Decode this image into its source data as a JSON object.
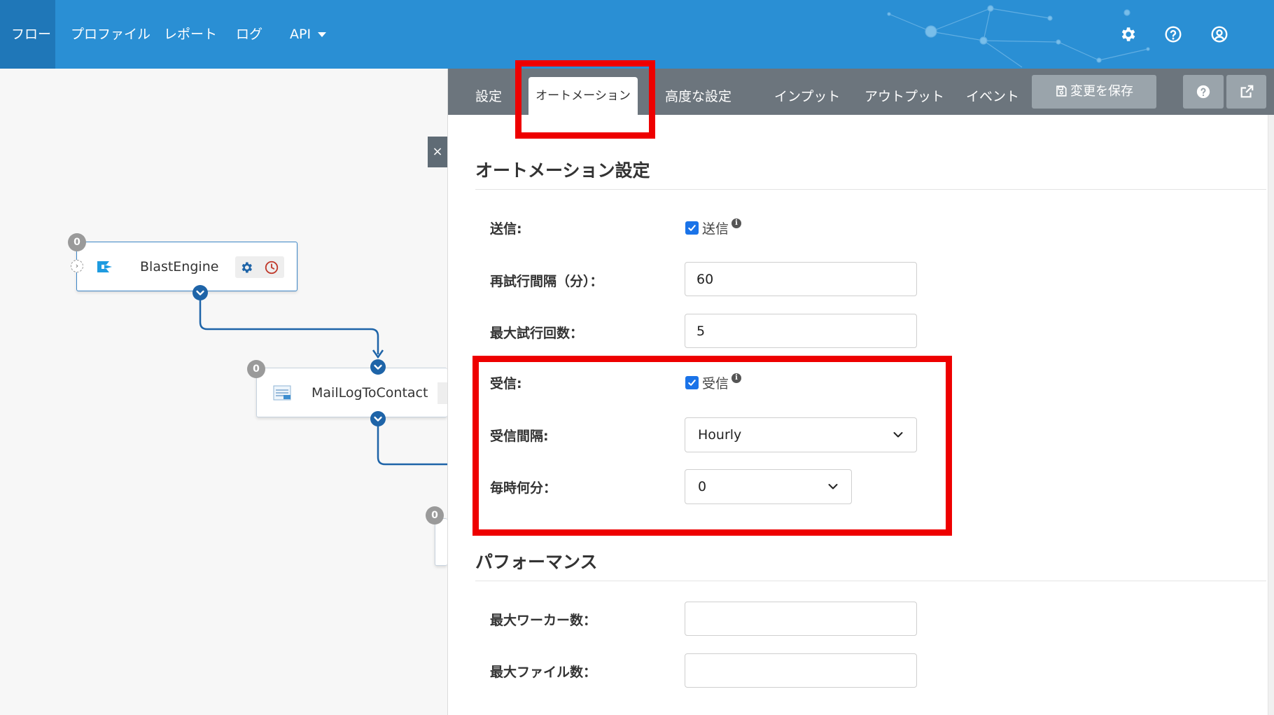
{
  "nav": {
    "items": [
      "フロー",
      "プロファイル",
      "レポート",
      "ログ",
      "API"
    ],
    "icons": [
      "gear-icon",
      "help-circle-icon",
      "user-circle-icon"
    ]
  },
  "flow": {
    "nodes": [
      {
        "label": "BlastEngine",
        "count": "0"
      },
      {
        "label": "MailLogToContact",
        "count": "0"
      },
      {
        "count": "0"
      }
    ],
    "close_label": "×"
  },
  "panel": {
    "tabs": [
      "設定",
      "オートメーション",
      "高度な設定",
      "インプット",
      "アウトプット",
      "イベント"
    ],
    "active_tab": "オートメーション",
    "save_label": "変更を保存",
    "sections": {
      "automation": {
        "title": "オートメーション設定",
        "send_label": "送信:",
        "send_checkbox": "送信",
        "send_checked": true,
        "retry_interval_label": "再試行間隔（分）：",
        "retry_interval_value": "60",
        "max_retry_label": "最大試行回数：",
        "max_retry_value": "5",
        "receive_label": "受信:",
        "receive_checkbox": "受信",
        "receive_checked": true,
        "receive_interval_label": "受信間隔:",
        "receive_interval_value": "Hourly",
        "minute_label": "毎時何分：",
        "minute_value": "0"
      },
      "performance": {
        "title": "パフォーマンス",
        "max_workers_label": "最大ワーカー数：",
        "max_workers_value": "",
        "max_files_label": "最大ファイル数：",
        "max_files_value": ""
      }
    }
  },
  "colors": {
    "topbar": "#2a8fd4",
    "topbar_active": "#1f77b8",
    "tabbar": "#6c757d",
    "highlight": "#ee0000",
    "checkbox": "#1a73e8",
    "connector": "#1e64a8"
  }
}
